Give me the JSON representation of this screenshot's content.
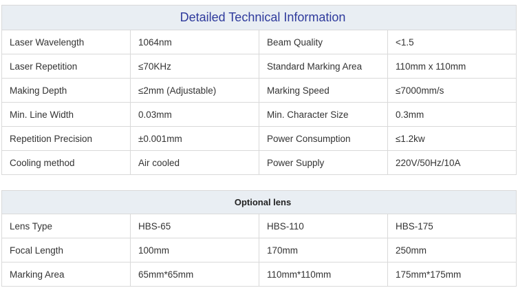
{
  "technical": {
    "title": "Detailed Technical Information",
    "rows": [
      [
        "Laser Wavelength",
        "1064nm",
        "Beam Quality",
        "<1.5"
      ],
      [
        "Laser Repetition",
        "≤70KHz",
        "Standard Marking Area",
        "110mm x 110mm"
      ],
      [
        "Making Depth",
        "≤2mm (Adjustable)",
        "Marking Speed",
        "≤7000mm/s"
      ],
      [
        "Min. Line Width",
        "0.03mm",
        "Min. Character Size",
        "0.3mm"
      ],
      [
        "Repetition Precision",
        "±0.001mm",
        "Power Consumption",
        "≤1.2kw"
      ],
      [
        "Cooling method",
        "Air cooled",
        "Power Supply",
        "220V/50Hz/10A"
      ]
    ]
  },
  "lens": {
    "title": "Optional lens",
    "rows": [
      [
        "Lens Type",
        "HBS-65",
        "HBS-110",
        "HBS-175"
      ],
      [
        "Focal Length",
        "100mm",
        "170mm",
        "250mm"
      ],
      [
        "Marking Area",
        "65mm*65mm",
        "110mm*110mm",
        "175mm*175mm"
      ]
    ]
  }
}
